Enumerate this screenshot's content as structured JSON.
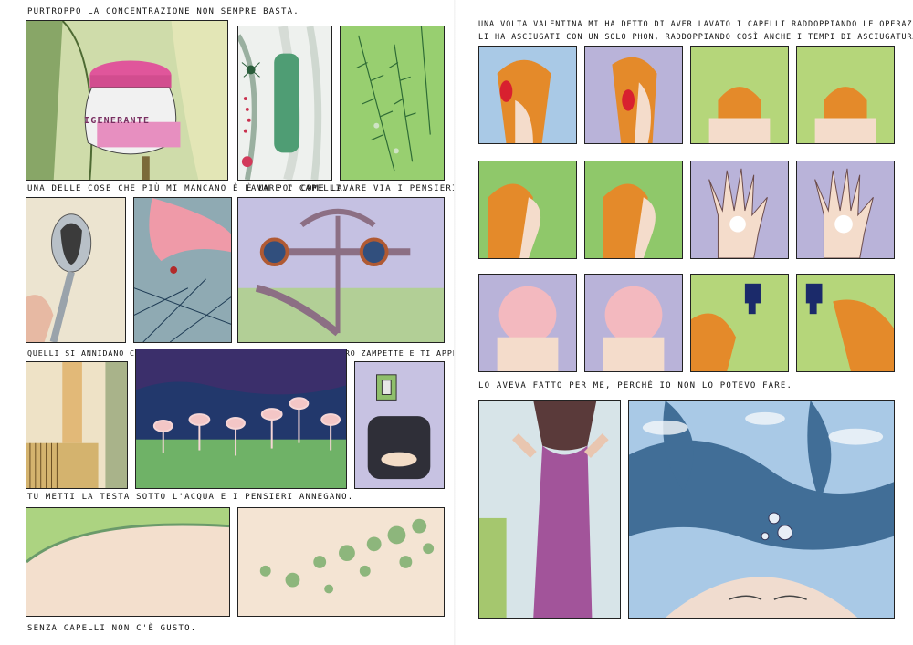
{
  "left_page": {
    "captions": [
      "Purtroppo la concentrazione non sempre basta.",
      "Una delle cose che più mi mancano è lavare i capelli.",
      "È un po' come lavare via i pensieri.",
      "Quelli si annidano come i pidocchi, si aggrappano con le loro zampette e ti appesantiscono la testa",
      "Tu metti la testa sotto l'acqua e i pensieri annegano.",
      "Senza capelli non c'è gusto."
    ],
    "jar_label": "IGENERANTE"
  },
  "right_page": {
    "captions": [
      "Una volta Valentina mi ha detto di aver lavato i capelli raddoppiando le operazioni.",
      "Li ha asciugati con un solo phon, raddoppiando così anche i tempi di asciugatura.",
      "Lo aveva fatto per me, perché io non lo potevo fare."
    ]
  },
  "colors": {
    "sky_blue": "#a9c9e6",
    "lilac": "#b9b3d9",
    "lime": "#b5d67a",
    "orange_hair": "#e48a2a",
    "green_panel": "#8fc86a",
    "flamingo_pink": "#f3c6c6",
    "water_green": "#6fb267",
    "night_blue": "#1f3a6e",
    "dress_purple": "#a2549a"
  }
}
